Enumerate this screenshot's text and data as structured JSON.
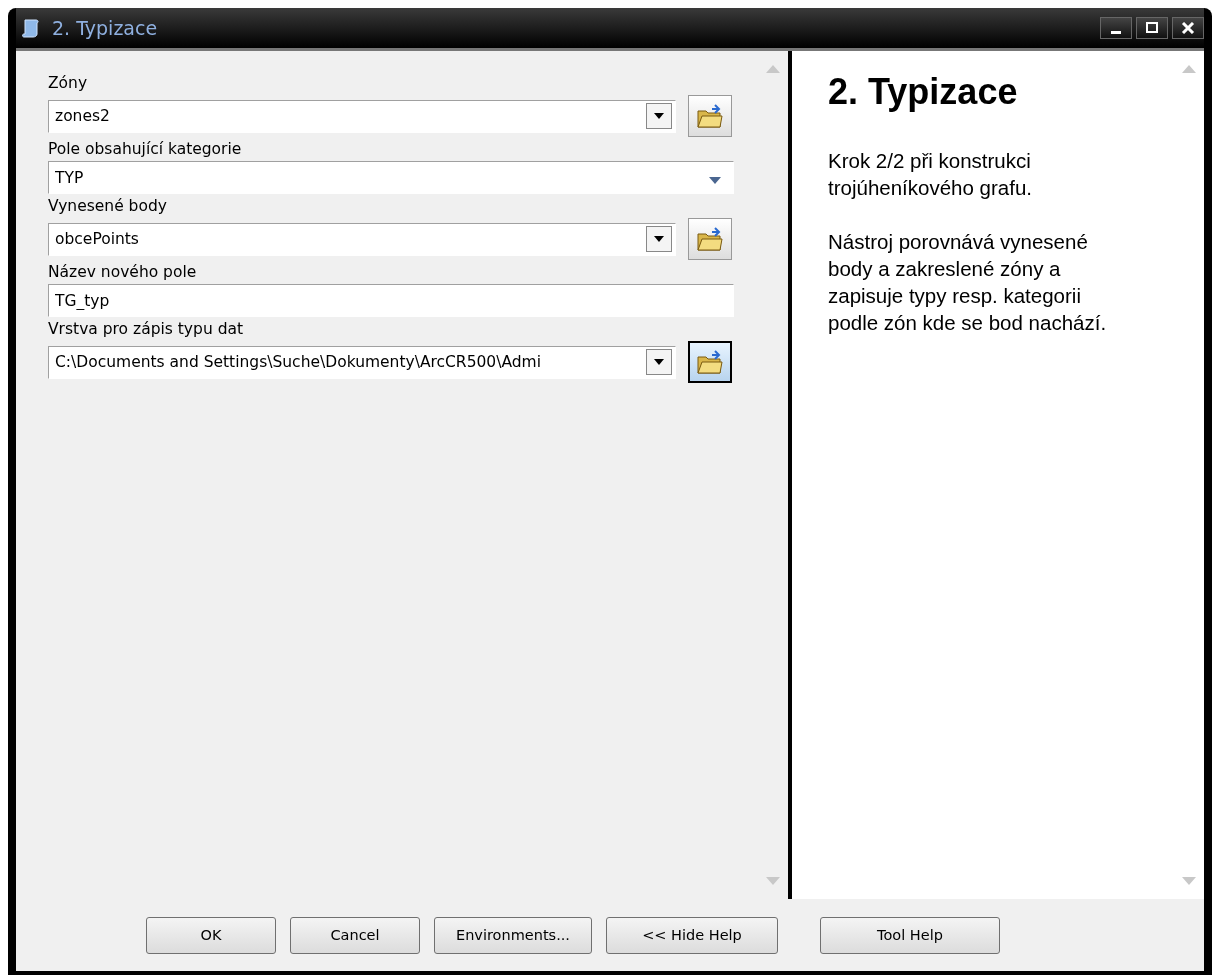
{
  "window": {
    "title": "2. Typizace"
  },
  "fields": [
    {
      "kind": "dropdown",
      "label": "Zóny",
      "value": "zones2",
      "focused": false
    },
    {
      "kind": "combo",
      "label": "Pole obsahující kategorie",
      "value": "TYP"
    },
    {
      "kind": "dropdown",
      "label": "Vynesené body",
      "value": "obcePoints",
      "focused": false
    },
    {
      "kind": "text",
      "label": "Název nového pole",
      "value": "TG_typ"
    },
    {
      "kind": "dropdown",
      "label": "Vrstva pro zápis typu dat",
      "value": "C:\\Documents and Settings\\Suche\\Dokumenty\\ArcCR500\\Admi",
      "focused": true
    }
  ],
  "help": {
    "title": "2. Typizace",
    "paragraphs": [
      "Krok 2/2 při konstrukci trojúheníkového grafu.",
      "Nástroj porovnává vynesené body a zakreslené zóny a zapisuje typy resp. kategorii podle zón kde se bod nachází."
    ]
  },
  "buttons": [
    "OK",
    "Cancel",
    "Environments...",
    "<< Hide Help",
    "Tool Help"
  ]
}
